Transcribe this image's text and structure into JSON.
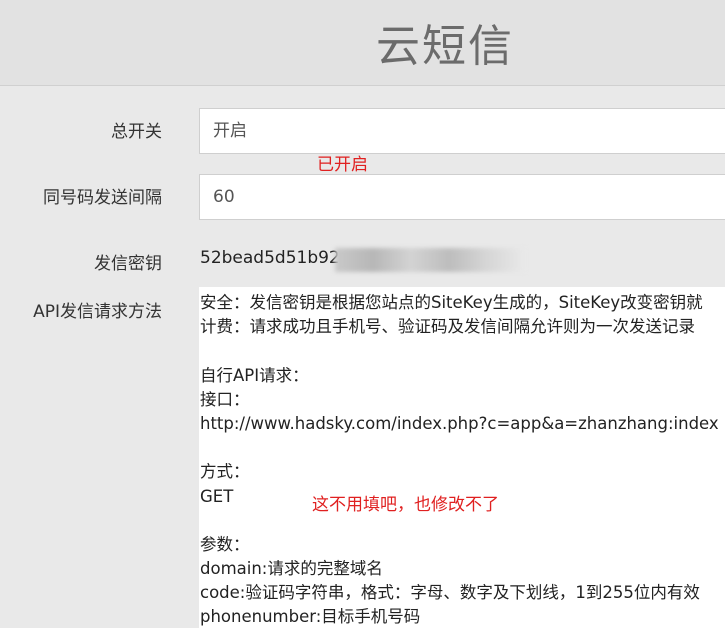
{
  "header": {
    "title": "云短信"
  },
  "form": {
    "switch_label": "总开关",
    "switch_value": "开启",
    "interval_label": "同号码发送间隔",
    "interval_value": "60",
    "key_label": "发信密钥",
    "key_value": "52bead5d51b92",
    "api_label": "API发信请求方法",
    "api_lines": [
      "安全：发信密钥是根据您站点的SiteKey生成的，SiteKey改变密钥就",
      "计费：请求成功且手机号、验证码及发信间隔允许则为一次发送记录",
      "",
      "自行API请求：",
      "接口：",
      "http://www.hadsky.com/index.php?c=app&a=zhanzhang:index",
      "",
      "方式：",
      "GET",
      "",
      "参数：",
      "domain:请求的完整域名",
      "code:验证码字符串，格式：字母、数字及下划线，1到255位内有效",
      "phonenumber:目标手机号码"
    ]
  },
  "annotations": {
    "enabled_note": "已开启",
    "no_fill_note": "这不用填吧，也修改不了"
  },
  "colors": {
    "annotation": "#e02020",
    "background": "#e9e9e9",
    "field_bg": "#ffffff"
  }
}
